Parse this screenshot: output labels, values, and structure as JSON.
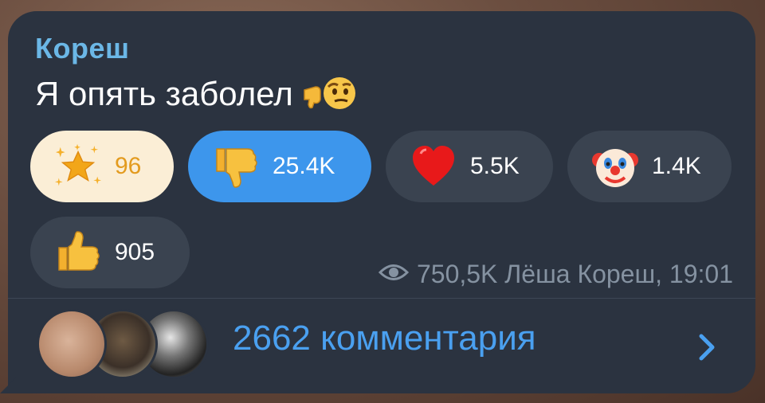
{
  "post": {
    "author": "Кореш",
    "text": "Я опять заболел",
    "text_emoji": "dislike-thinking-emoji"
  },
  "reactions": [
    {
      "name": "star",
      "icon": "star-icon",
      "count": "96",
      "selected": true
    },
    {
      "name": "dislike",
      "icon": "thumbs-down-icon",
      "count": "25.4K",
      "highlighted": true
    },
    {
      "name": "heart",
      "icon": "heart-icon",
      "count": "5.5K"
    },
    {
      "name": "clown",
      "icon": "clown-face-icon",
      "count": "1.4K"
    },
    {
      "name": "like",
      "icon": "thumbs-up-icon",
      "count": "905"
    }
  ],
  "meta": {
    "views": "750,5K",
    "signature": "Лёша Кореш, 19:01"
  },
  "comments": {
    "label": "2662 комментария"
  },
  "colors": {
    "bubble": "#2b3340",
    "author": "#6bb7e6",
    "accent": "#3d96ec",
    "link": "#4aa0f0",
    "meta": "#8592a1"
  }
}
